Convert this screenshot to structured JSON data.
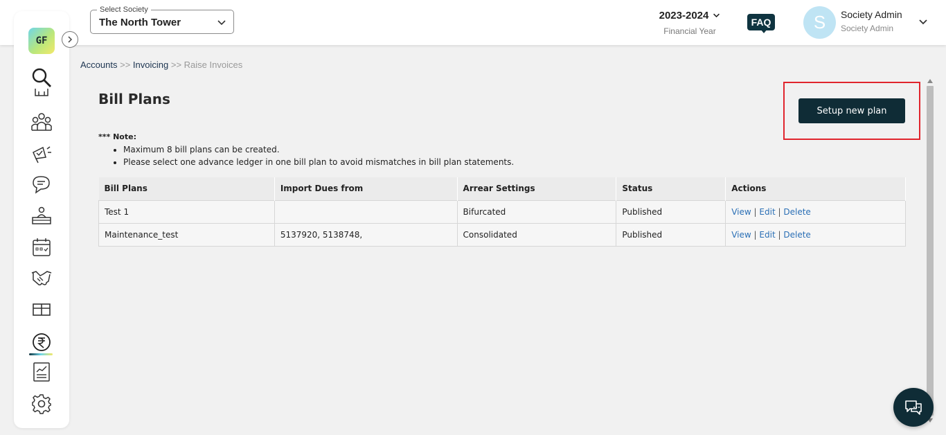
{
  "header": {
    "society_select": {
      "label": "Select Society",
      "value": "The North Tower"
    },
    "financial_year": {
      "value": "2023-2024",
      "caption": "Financial Year"
    },
    "faq_label": "FAQ",
    "user": {
      "initial": "S",
      "name": "Society Admin",
      "role": "Society Admin"
    }
  },
  "sidebar": {
    "logo_text": "GF",
    "icons": [
      "search-icon",
      "building-icon",
      "members-icon",
      "announcement-icon",
      "chat-icon",
      "helpdesk-icon",
      "calendar-icon",
      "handshake-icon",
      "box-icon",
      "rupee-icon",
      "report-icon",
      "settings-icon"
    ],
    "active": "rupee-icon"
  },
  "breadcrumb": {
    "items": [
      "Accounts",
      "Invoicing",
      "Raise Invoices"
    ],
    "separator": ">>"
  },
  "page": {
    "title": "Bill Plans",
    "setup_button": "Setup new plan"
  },
  "note": {
    "title": "*** Note:",
    "items": [
      "Maximum 8 bill plans can be created.",
      "Please select one advance ledger in one bill plan to avoid mismatches in bill plan statements."
    ]
  },
  "table": {
    "columns": [
      "Bill Plans",
      "Import Dues from",
      "Arrear Settings",
      "Status",
      "Actions"
    ],
    "rows": [
      {
        "bill_plan": "Test 1",
        "import_dues_from": "",
        "arrear_settings": "Bifurcated",
        "status": "Published",
        "actions": [
          "View",
          "Edit",
          "Delete"
        ]
      },
      {
        "bill_plan": "Maintenance_test",
        "import_dues_from": "5137920, 5138748,",
        "arrear_settings": "Consolidated",
        "status": "Published",
        "actions": [
          "View",
          "Edit",
          "Delete"
        ]
      }
    ],
    "action_separator": "|"
  },
  "colors": {
    "primary_dark": "#0f2c36",
    "highlight_border": "#e0242c",
    "link": "#2a6fb5",
    "avatar_bg": "#bfe4f4"
  }
}
